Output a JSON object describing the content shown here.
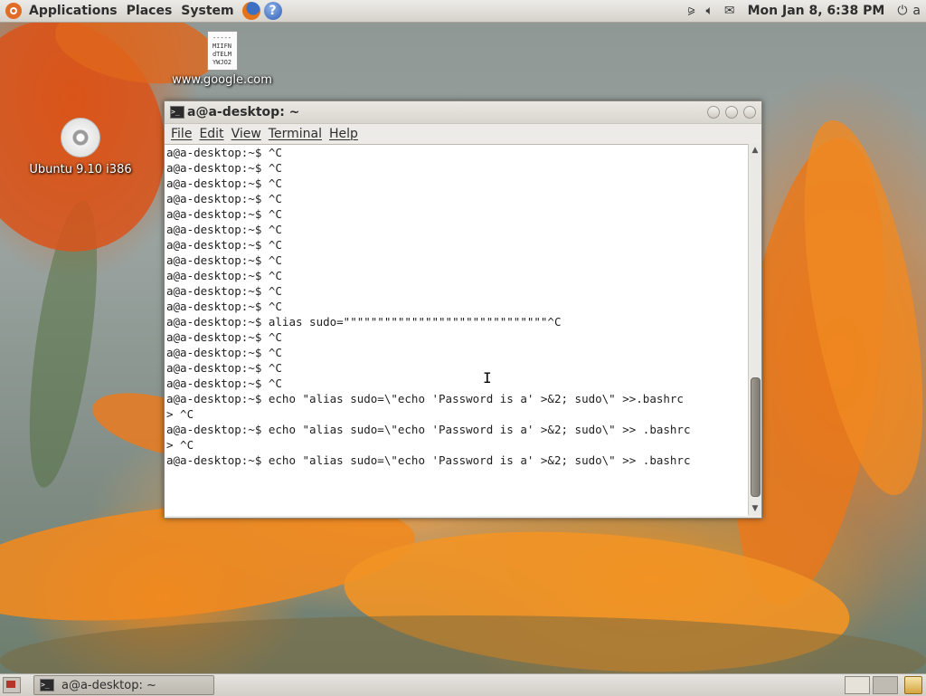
{
  "top_panel": {
    "menus": [
      "Applications",
      "Places",
      "System"
    ],
    "clock": "Mon Jan  8,  6:38 PM",
    "user": "a"
  },
  "desktop_icons": {
    "file": {
      "label": "www.google.com",
      "thumb_text": "-----\nMIIFN\ndTELM\nYWJO2"
    },
    "cd": {
      "label": "Ubuntu 9.10 i386"
    }
  },
  "window": {
    "title": "a@a-desktop: ~",
    "menus": [
      "File",
      "Edit",
      "View",
      "Terminal",
      "Help"
    ]
  },
  "terminal": {
    "lines": [
      "a@a-desktop:~$ ^C",
      "a@a-desktop:~$ ^C",
      "a@a-desktop:~$ ^C",
      "a@a-desktop:~$ ^C",
      "a@a-desktop:~$ ^C",
      "a@a-desktop:~$ ^C",
      "a@a-desktop:~$ ^C",
      "a@a-desktop:~$ ^C",
      "a@a-desktop:~$ ^C",
      "a@a-desktop:~$ ^C",
      "a@a-desktop:~$ ^C",
      "a@a-desktop:~$ alias sudo=\"\"\"\"\"\"\"\"\"\"\"\"\"\"\"\"\"\"\"\"\"\"\"\"\"\"\"\"\"\"^C",
      "a@a-desktop:~$ ^C",
      "a@a-desktop:~$ ^C",
      "a@a-desktop:~$ ^C",
      "a@a-desktop:~$ ^C",
      "a@a-desktop:~$ echo \"alias sudo=\\\"echo 'Password is a' >&2; sudo\\\" >>.bashrc",
      "> ^C",
      "a@a-desktop:~$ echo \"alias sudo=\\\"echo 'Password is a' >&2; sudo\\\" >> .bashrc",
      "> ^C",
      "a@a-desktop:~$ echo \"alias sudo=\\\"echo 'Password is a' >&2; sudo\\\" >> .bashrc"
    ]
  },
  "taskbar": {
    "task_label": "a@a-desktop: ~"
  },
  "colors": {
    "panel": "#dcd9d2",
    "terminal_bg": "#ffffff",
    "terminal_fg": "#1f1f1f"
  }
}
